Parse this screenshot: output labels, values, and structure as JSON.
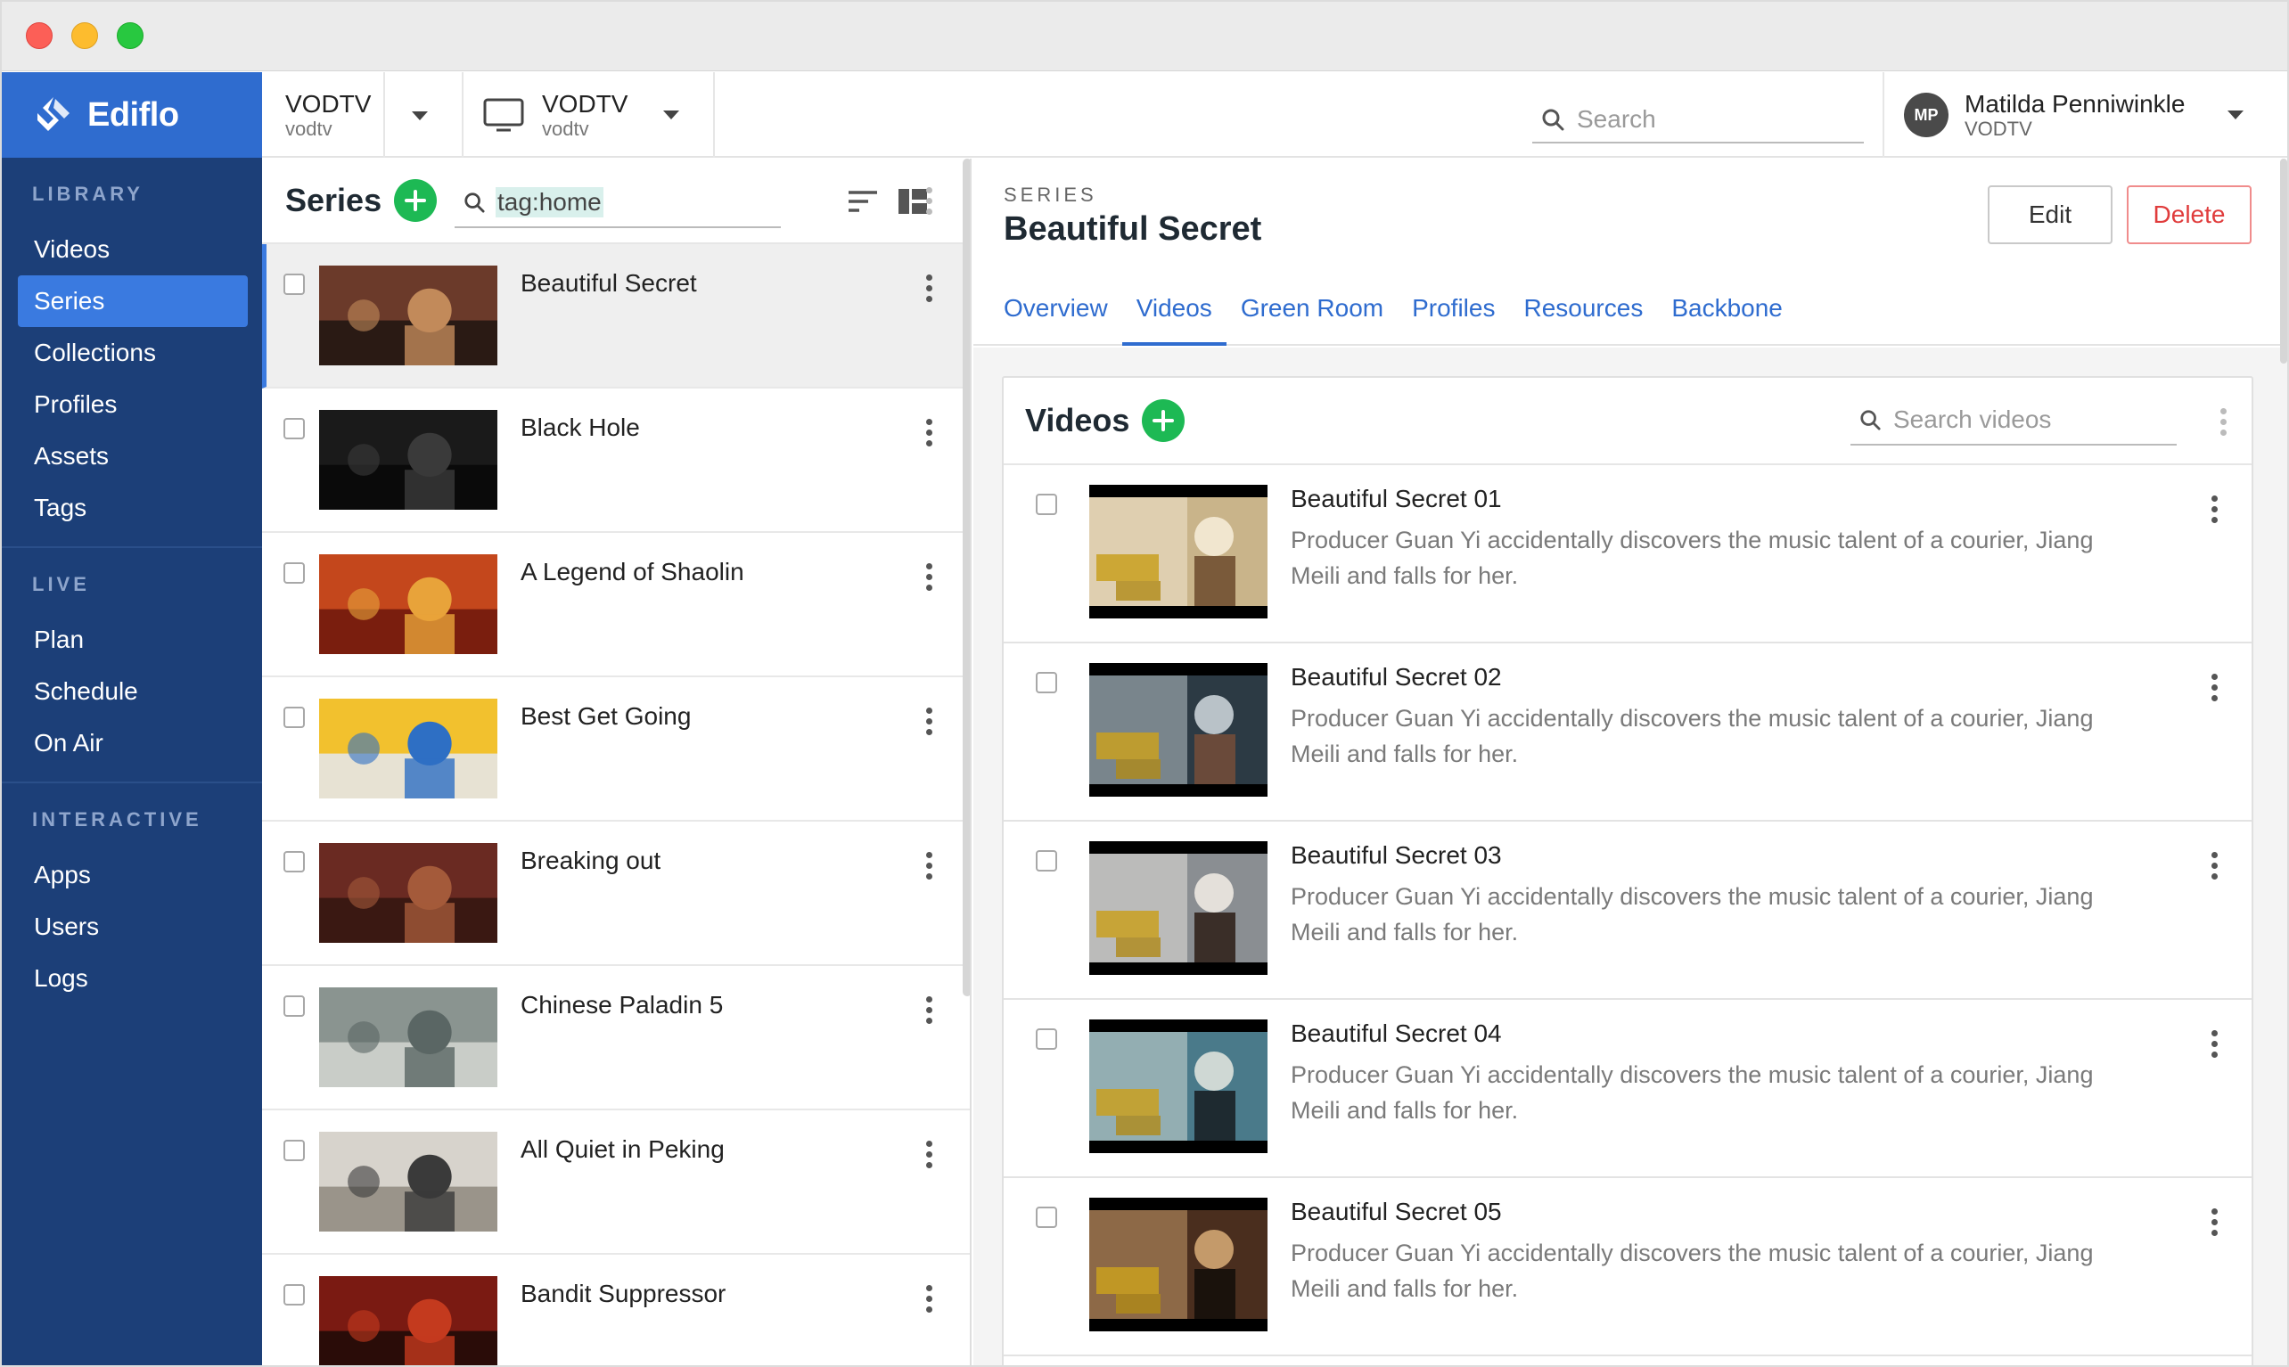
{
  "window": {
    "controls": [
      "close",
      "minimize",
      "zoom"
    ]
  },
  "brand": {
    "name": "Ediflo",
    "color": "#2f6ccf"
  },
  "sidebar": {
    "sections": [
      {
        "heading": "LIBRARY",
        "items": [
          {
            "label": "Videos",
            "active": false
          },
          {
            "label": "Series",
            "active": true
          },
          {
            "label": "Collections",
            "active": false
          },
          {
            "label": "Profiles",
            "active": false
          },
          {
            "label": "Assets",
            "active": false
          },
          {
            "label": "Tags",
            "active": false
          }
        ]
      },
      {
        "heading": "LIVE",
        "items": [
          {
            "label": "Plan",
            "active": false
          },
          {
            "label": "Schedule",
            "active": false
          },
          {
            "label": "On Air",
            "active": false
          }
        ]
      },
      {
        "heading": "INTERACTIVE",
        "items": [
          {
            "label": "Apps",
            "active": false
          },
          {
            "label": "Users",
            "active": false
          },
          {
            "label": "Logs",
            "active": false
          }
        ]
      }
    ]
  },
  "topbar": {
    "org": {
      "name": "VODTV",
      "slug": "vodtv"
    },
    "channel": {
      "name": "VODTV",
      "slug": "vodtv",
      "icon": "monitor-icon"
    },
    "search": {
      "placeholder": "Search",
      "value": ""
    },
    "user": {
      "initials": "MP",
      "name": "Matilda Penniwinkle",
      "org": "VODTV"
    }
  },
  "list": {
    "title": "Series",
    "search": {
      "value": "tag:home"
    },
    "items": [
      {
        "name": "Beautiful Secret",
        "selected": true,
        "thumb_colors": [
          "#6b3a2a",
          "#c28a5a",
          "#2a1a14"
        ]
      },
      {
        "name": "Black Hole",
        "selected": false,
        "thumb_colors": [
          "#1a1a1a",
          "#3a3a3a",
          "#0a0a0a"
        ]
      },
      {
        "name": "A Legend of Shaolin",
        "selected": false,
        "thumb_colors": [
          "#c4471c",
          "#e8a33a",
          "#7a1e0e"
        ]
      },
      {
        "name": "Best Get Going",
        "selected": false,
        "thumb_colors": [
          "#f2c12e",
          "#2e6fc4",
          "#e7e2d3"
        ]
      },
      {
        "name": "Breaking out",
        "selected": false,
        "thumb_colors": [
          "#6a2a22",
          "#a45a3a",
          "#3a1812"
        ]
      },
      {
        "name": "Chinese Paladin 5",
        "selected": false,
        "thumb_colors": [
          "#8a9490",
          "#5a6664",
          "#c9cdc8"
        ]
      },
      {
        "name": "All Quiet in Peking",
        "selected": false,
        "thumb_colors": [
          "#d7d3cc",
          "#3a3a3a",
          "#9a948a"
        ]
      },
      {
        "name": "Bandit Suppressor",
        "selected": false,
        "thumb_colors": [
          "#7a1a12",
          "#c43a1e",
          "#2a0c08"
        ]
      }
    ]
  },
  "detail": {
    "overline": "SERIES",
    "title": "Beautiful Secret",
    "actions": {
      "edit": "Edit",
      "delete": "Delete"
    },
    "tabs": [
      {
        "label": "Overview",
        "active": false
      },
      {
        "label": "Videos",
        "active": true
      },
      {
        "label": "Green Room",
        "active": false
      },
      {
        "label": "Profiles",
        "active": false
      },
      {
        "label": "Resources",
        "active": false
      },
      {
        "label": "Backbone",
        "active": false
      }
    ],
    "videos": {
      "title": "Videos",
      "search_placeholder": "Search videos",
      "items": [
        {
          "title": "Beautiful Secret 01",
          "description": "Producer Guan Yi accidentally discovers the music talent of a courier, Jiang Meili and falls for her.",
          "thumb_colors": [
            "#c9b48a",
            "#f1e6cf",
            "#7a5a3a"
          ]
        },
        {
          "title": "Beautiful Secret 02",
          "description": "Producer Guan Yi accidentally discovers the music talent of a courier, Jiang Meili and falls for her.",
          "thumb_colors": [
            "#2c3a44",
            "#b9c2c8",
            "#6a4a3a"
          ]
        },
        {
          "title": "Beautiful Secret 03",
          "description": "Producer Guan Yi accidentally discovers the music talent of a courier, Jiang Meili and falls for her.",
          "thumb_colors": [
            "#8a8e92",
            "#e4e0da",
            "#3a2e28"
          ]
        },
        {
          "title": "Beautiful Secret 04",
          "description": "Producer Guan Yi accidentally discovers the music talent of a courier, Jiang Meili and falls for her.",
          "thumb_colors": [
            "#4a7a8a",
            "#cfd8d4",
            "#1e2a30"
          ]
        },
        {
          "title": "Beautiful Secret 05",
          "description": "Producer Guan Yi accidentally discovers the music talent of a courier, Jiang Meili and falls for her.",
          "thumb_colors": [
            "#4a2e1e",
            "#c49a6a",
            "#1a120c"
          ]
        }
      ]
    }
  },
  "colors": {
    "sidebar_bg": "#1c3f78",
    "active_nav": "#3a7ae0",
    "add_button": "#1db954",
    "link_blue": "#2f6ccf",
    "danger": "#e03c3c"
  }
}
